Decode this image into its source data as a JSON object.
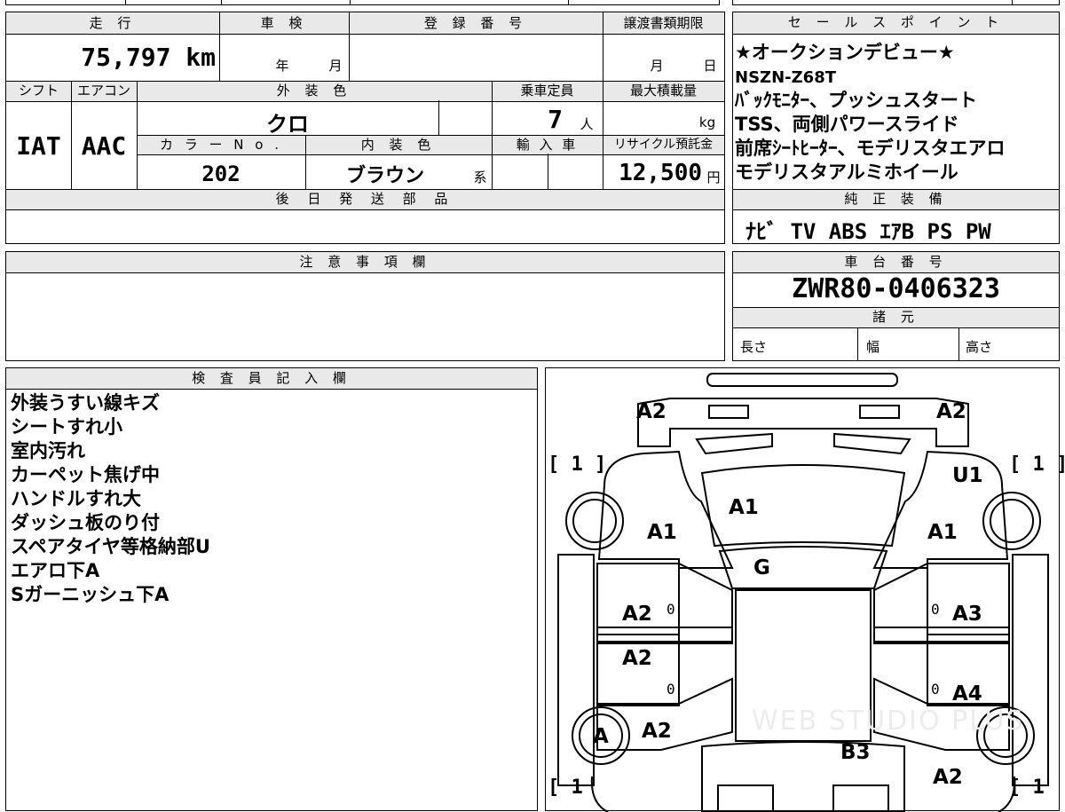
{
  "main": {
    "labels": {
      "mileage": "走 行",
      "shaken": "車 検",
      "registration": "登 録 番 号",
      "transfer": "譲渡書類期限",
      "shift": "シフト",
      "aircon": "エアコン",
      "exterior_color": "外 装 色",
      "capacity": "乗車定員",
      "max_load": "最大積載量",
      "color_no": "カ ラ ー N o .",
      "interior_color": "内 装 色",
      "import": "輸 入 車",
      "recycle": "リサイクル預託金",
      "later_parts": "後 日 発 送 部 品"
    },
    "mileage_value": "75,797 km",
    "shaken_year": "年",
    "shaken_month": "月",
    "transfer_month": "月",
    "transfer_day": "日",
    "shift_value": "IAT",
    "aircon_value": "AAC",
    "exterior_color_value": "クロ",
    "capacity_value": "7",
    "capacity_unit": "人",
    "max_load_unit": "kg",
    "color_no_value": "202",
    "interior_color_value": "ブラウン",
    "interior_suffix": "系",
    "recycle_value": "12,500",
    "recycle_unit": "円"
  },
  "sales_points": {
    "header": "セ ー ル ス ポ イ ン ト",
    "lines": [
      "★オークションデビュー★",
      "NSZN-Z68T",
      "ﾊﾞｯｸﾓﾆﾀｰ、プッシュスタート",
      "TSS、両側パワースライド",
      "前席ｼｰﾄﾋｰﾀｰ、モデリスタエアロ",
      "モデリスタアルミホイール"
    ]
  },
  "equipment": {
    "header": "純 正 装 備",
    "value": "ﾅﾋﾞ TV ABS ｴｱB PS PW"
  },
  "notes": {
    "header": "注 意 事 項 欄"
  },
  "chassis": {
    "header": "車 台 番 号",
    "value": "ZWR80-0406323"
  },
  "specs": {
    "header": "諸 元",
    "length": "長さ",
    "width": "幅",
    "height": "高さ"
  },
  "inspector": {
    "header": "検 査 員 記 入 欄",
    "lines": [
      "外装うすい線キズ",
      "シートすれ小",
      "室内汚れ",
      "カーペット焦げ中",
      "ハンドルすれ大",
      "ダッシュ板のり付",
      "スペアタイヤ等格納部U",
      "エアロ下A",
      "Sガーニッシュ下A"
    ]
  },
  "diagram": {
    "marks": {
      "front_left": "A2",
      "front_right": "A2",
      "fender_left": "A1",
      "fender_right": "A1",
      "hood": "A1",
      "roof": "G",
      "right_u": "U1",
      "door_front_left": "A2",
      "door_front_right": "A3",
      "door_rear_left": "A2",
      "door_rear_right": "A4",
      "rear_fender_left": "A2",
      "wheel_rear_left": "A",
      "rear_glass": "B3",
      "rear_right": "A2"
    },
    "tire_left_front": "[ 1 ]",
    "tire_right_front": "[ 1 ]",
    "tire_left_rear": "[ 1",
    "tire_right_rear": "[ 1",
    "zero1": "0",
    "zero2": "0",
    "zero3": "0",
    "zero4": "0",
    "watermark": "WEB STUDIO PLUS"
  }
}
